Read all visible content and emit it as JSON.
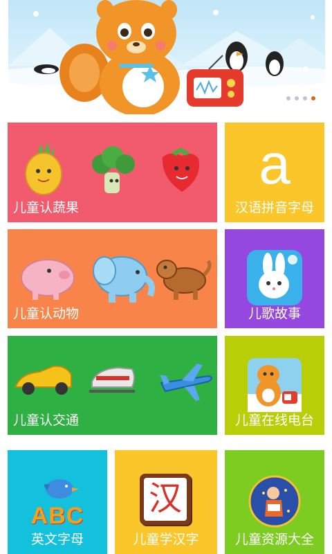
{
  "banner": {
    "slides": 4,
    "active_slide": 4
  },
  "tiles": {
    "fruits_veg": {
      "label": "儿童认蔬果",
      "color": "#f25a6d"
    },
    "pinyin": {
      "label": "汉语拼音字母",
      "color": "#fbc62a",
      "glyph": "a"
    },
    "animals": {
      "label": "儿童认动物",
      "color": "#f9844a"
    },
    "songs_stories": {
      "label": "儿歌故事",
      "color": "#9448df"
    },
    "transport": {
      "label": "儿童认交通",
      "color": "#2fb042"
    },
    "radio": {
      "label": "儿童在线电台",
      "color": "#b8cf07"
    },
    "english_letters": {
      "label": "英文字母",
      "color": "#13c1dc",
      "icon_text": "ABC"
    },
    "chinese_chars": {
      "label": "儿童学汉字",
      "color": "#fbc62a",
      "icon_text": "汉"
    },
    "resources": {
      "label": "儿童资源大全",
      "color": "#7dcc21"
    }
  }
}
